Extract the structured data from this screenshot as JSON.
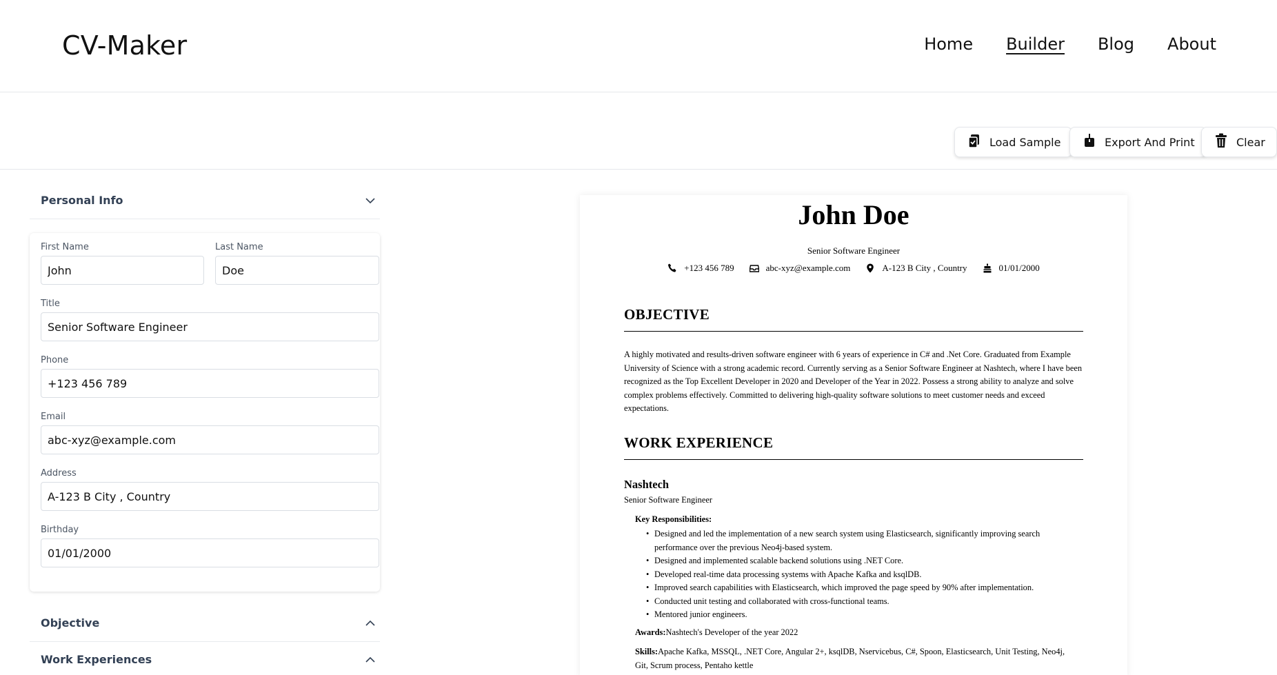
{
  "header": {
    "logo": "CV-Maker",
    "nav": [
      "Home",
      "Builder",
      "Blog",
      "About"
    ],
    "active_nav": "Builder"
  },
  "toolbar": {
    "load_sample": "Load Sample",
    "export_print": "Export And Print",
    "clear": "Clear"
  },
  "sections": {
    "personal_info": "Personal Info",
    "objective": "Objective",
    "work_experiences": "Work Experiences"
  },
  "form": {
    "first_name_label": "First Name",
    "first_name": "John",
    "last_name_label": "Last Name",
    "last_name": "Doe",
    "title_label": "Title",
    "title": "Senior Software Engineer",
    "phone_label": "Phone",
    "phone": "+123 456 789",
    "email_label": "Email",
    "email": "abc-xyz@example.com",
    "address_label": "Address",
    "address": "A-123 B City , Country",
    "birthday_label": "Birthday",
    "birthday": "01/01/2000"
  },
  "cv": {
    "name": "John Doe",
    "title": "Senior Software Engineer",
    "phone": "+123 456 789",
    "email": "abc-xyz@example.com",
    "address": "A-123 B City , Country",
    "birthday": "01/01/2000",
    "objective_heading": "OBJECTIVE",
    "objective_text": "A highly motivated and results-driven software engineer with 6 years of experience in C# and .Net Core. Graduated from Example University of Science with a strong academic record. Currently serving as a Senior Software Engineer at Nashtech, where I have been recognized as the Top Excellent Developer in 2020 and Developer of the Year in 2022. Possess a strong ability to analyze and solve complex problems effectively. Committed to delivering high-quality software solutions to meet customer needs and exceed expectations.",
    "work_heading": "WORK EXPERIENCE",
    "job": {
      "company": "Nashtech",
      "role": "Senior Software Engineer",
      "responsibilities_label": "Key Responsibilities:",
      "responsibilities": [
        "Designed and led the implementation of a new search system using Elasticsearch, significantly improving search performance over the previous Neo4j-based system.",
        "Designed and implemented scalable backend solutions using .NET Core.",
        "Developed real-time data processing systems with Apache Kafka and ksqlDB.",
        "Improved search capabilities with Elasticsearch, which improved the page speed by 90% after implementation.",
        "Conducted unit testing and collaborated with cross-functional teams.",
        "Mentored junior engineers."
      ],
      "awards_label": "Awards:",
      "awards": "Nashtech's Developer of the year 2022",
      "skills_label": "Skills:",
      "skills": "Apache Kafka, MSSQL, .NET Core, Angular 2+, ksqlDB, Nservicebus, C#, Spoon, Elasticsearch, Unit Testing, Neo4j, Git, Scrum process, Pentaho kettle"
    }
  }
}
